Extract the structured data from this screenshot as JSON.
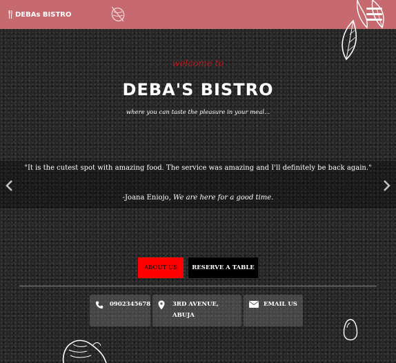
{
  "colors": {
    "navbar_background": "#c66a6f",
    "welcome_text": "#c4161c",
    "about_button": "#ff0000",
    "reserve_button": "#000000"
  },
  "navbar": {
    "brand_text": "DEBAs BISTRO",
    "brand_icon": "fork-knife-icon",
    "logo_icon": "food-logo-icon",
    "menu_icon": "hamburger-menu-icon"
  },
  "hero": {
    "welcome": "welcome to",
    "title": "DEBA'S BISTRO",
    "tagline": "where you can taste the pleasure in your meal..."
  },
  "testimonial": {
    "quote": "\"It is the cutest spot with amazing food. The service was amazing and I'll definitely be back again.\"",
    "author": "-Joana Eniojo, ",
    "author_note": "We are here for a good time.",
    "prev_icon": "chevron-left-icon",
    "next_icon": "chevron-right-icon"
  },
  "buttons": {
    "about": "About Us",
    "reserve": "Reserve a Table"
  },
  "contacts": {
    "phone": {
      "icon": "phone-icon",
      "text": "0902345678"
    },
    "address": {
      "icon": "map-pin-icon",
      "line1": "3rd Avenue,",
      "line2": "Abuja"
    },
    "email": {
      "icon": "envelope-icon",
      "text": "Email Us"
    }
  }
}
